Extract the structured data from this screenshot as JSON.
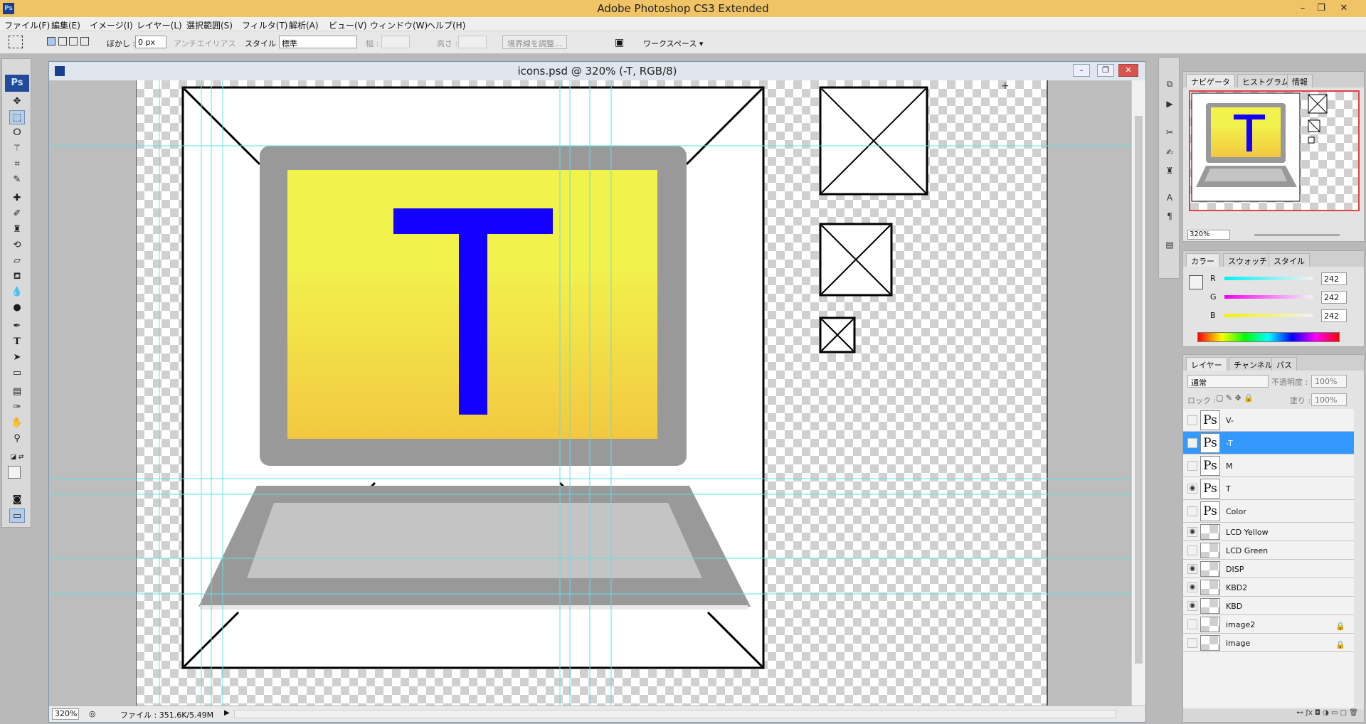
{
  "app": {
    "title": "Adobe Photoshop CS3 Extended",
    "icon": "Ps"
  },
  "window_controls": [
    "–",
    "❐",
    "✕"
  ],
  "menu": [
    "ファイル(F)",
    "編集(E)",
    "イメージ(I)",
    "レイヤー(L)",
    "選択範囲(S)",
    "フィルタ(T)",
    "解析(A)",
    "ビュー(V)",
    "ウィンドウ(W)",
    "ヘルプ(H)"
  ],
  "options": {
    "feather_label": "ぼかし :",
    "feather_value": "0 px",
    "antialias_label": "アンチエイリアス",
    "style_label": "スタイル :",
    "style_value": "標準",
    "width_label": "幅 :",
    "height_label": "高さ :",
    "refine_edge": "境界線を調整...",
    "workspace": "ワークスペース ▾"
  },
  "tools_panel": {
    "logo": "Ps"
  },
  "document": {
    "title": "icons.psd @ 320% (-T, RGB/8)",
    "zoom": "320%",
    "file_info": "ファイル : 351.6K/5.49M",
    "monitor_letter": "T",
    "lcd_colors": [
      "#f2f24d",
      "#f2c840"
    ],
    "letter_color": "#1400ff",
    "frame_gray": "#999999",
    "keyboard_gray": "#c4c4c4",
    "guide_color": "#5fe0e6"
  },
  "navigator": {
    "tabs": [
      "ナビゲータ",
      "ヒストグラム",
      "情報"
    ],
    "zoom": "320%"
  },
  "color_panel": {
    "tabs": [
      "カラー",
      "スウォッチ",
      "スタイル"
    ],
    "channels": [
      {
        "name": "R",
        "value": "242",
        "grad": "linear-gradient(90deg,#00f2f2,#f2f2f2)"
      },
      {
        "name": "G",
        "value": "242",
        "grad": "linear-gradient(90deg,#f200f2,#f2f2f2)"
      },
      {
        "name": "B",
        "value": "242",
        "grad": "linear-gradient(90deg,#f2f200,#f2f2f2)"
      }
    ]
  },
  "layers_panel": {
    "tabs": [
      "レイヤー",
      "チャンネル",
      "パス"
    ],
    "blend_mode": "通常",
    "opacity_label": "不透明度 :",
    "opacity_value": "100%",
    "lock_label": "ロック :",
    "fill_label": "塗り :",
    "fill_value": "100%",
    "layers": [
      {
        "name": "V-",
        "type": "text",
        "visible": false,
        "selected": false,
        "locked": false
      },
      {
        "name": "-T",
        "type": "text",
        "visible": false,
        "selected": true,
        "locked": false
      },
      {
        "name": "M",
        "type": "text",
        "visible": false,
        "selected": false,
        "locked": false
      },
      {
        "name": "T",
        "type": "text",
        "visible": true,
        "selected": false,
        "locked": false
      },
      {
        "name": "Color",
        "type": "text",
        "visible": false,
        "selected": false,
        "locked": false
      },
      {
        "name": "LCD Yellow",
        "type": "image",
        "visible": true,
        "selected": false,
        "locked": false
      },
      {
        "name": "LCD Green",
        "type": "image",
        "visible": false,
        "selected": false,
        "locked": false
      },
      {
        "name": "DISP",
        "type": "image",
        "visible": true,
        "selected": false,
        "locked": false
      },
      {
        "name": "KBD2",
        "type": "image",
        "visible": true,
        "selected": false,
        "locked": false
      },
      {
        "name": "KBD",
        "type": "image",
        "visible": true,
        "selected": false,
        "locked": false
      },
      {
        "name": "image2",
        "type": "image",
        "visible": false,
        "selected": false,
        "locked": true
      },
      {
        "name": "image",
        "type": "image",
        "visible": false,
        "selected": false,
        "locked": true
      }
    ]
  }
}
